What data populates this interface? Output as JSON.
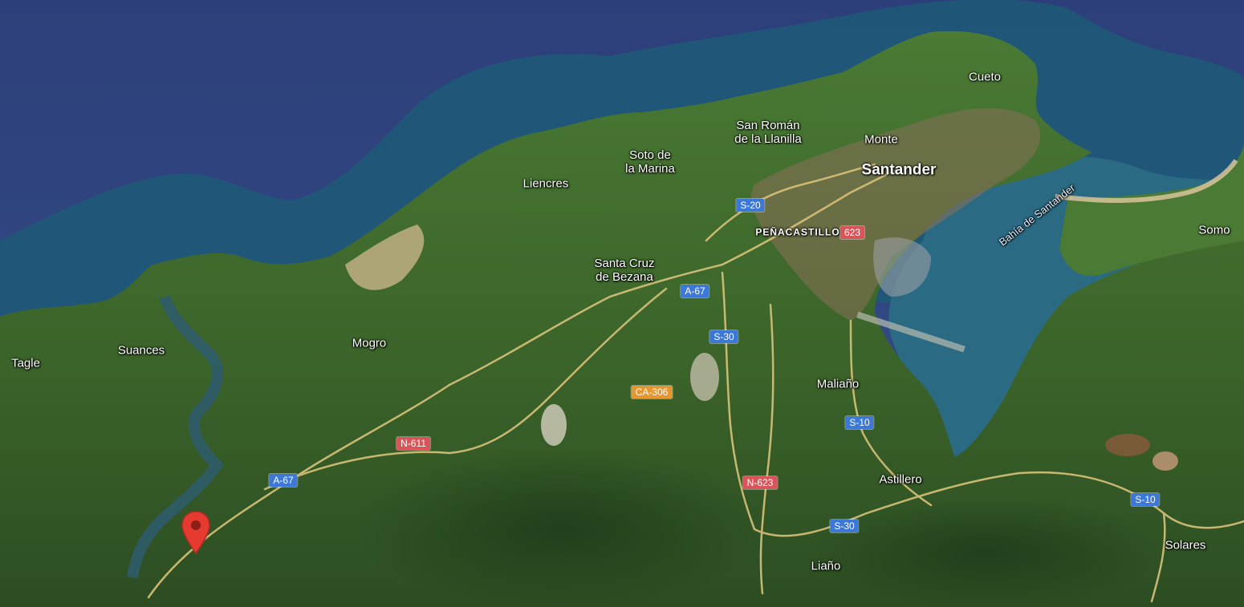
{
  "map": {
    "colors": {
      "sea_deep": "#2d3f78",
      "sea_coast": "#1f5a7a",
      "land": "#3f6a2e",
      "urban": "#8a6f58",
      "road": "#d8c27a",
      "shield_blue": "#3b78d8",
      "shield_red": "#d8555a",
      "shield_orange": "#e39631",
      "pin": "#e43a30"
    },
    "places": [
      {
        "name": "Cueto"
      },
      {
        "name": "San Román\nde la Llanilla"
      },
      {
        "name": "Monte"
      },
      {
        "name": "Santander"
      },
      {
        "name": "Soto de\nla Marina"
      },
      {
        "name": "Liencres"
      },
      {
        "name": "PEÑACASTILLO"
      },
      {
        "name": "Somo"
      },
      {
        "name": "Santa Cruz\nde Bezana"
      },
      {
        "name": "Suances"
      },
      {
        "name": "Tagle"
      },
      {
        "name": "Mogro"
      },
      {
        "name": "Maliaño"
      },
      {
        "name": "Astillero"
      },
      {
        "name": "Solares"
      },
      {
        "name": "Liaño"
      },
      {
        "name": "Bahía de Santander"
      }
    ],
    "road_shields": [
      {
        "label": "S-20"
      },
      {
        "label": "A-67"
      },
      {
        "label": "S-30"
      },
      {
        "label": "CA-306"
      },
      {
        "label": "S-10"
      },
      {
        "label": "N-611"
      },
      {
        "label": "A-67"
      },
      {
        "label": "N-623"
      },
      {
        "label": "S-30"
      },
      {
        "label": "S-10"
      },
      {
        "label": "623"
      }
    ],
    "marker": {
      "icon": "map-pin-icon"
    }
  }
}
